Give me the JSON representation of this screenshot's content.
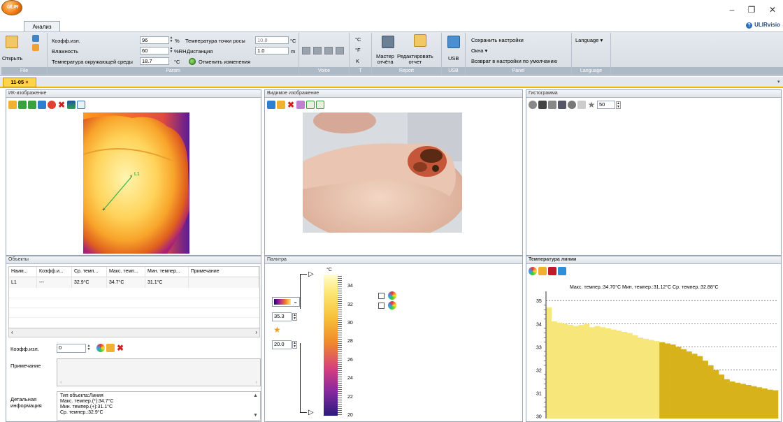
{
  "window": {
    "app_name": "ULIRvisio",
    "minimize": "–",
    "restore": "❐",
    "close": "✕",
    "logo_text": "ULIR"
  },
  "tabs": {
    "analysis": "Анализ"
  },
  "ribbon": {
    "file": {
      "label": "File",
      "open": "Открыть"
    },
    "param": {
      "label": "Param",
      "emissivity_label": "Коэфф.изл.",
      "emissivity_value": "96",
      "emissivity_unit": "%",
      "humidity_label": "Влажность",
      "humidity_value": "60",
      "humidity_unit": "%RH",
      "ambient_label": "Температура окружающей среды",
      "ambient_value": "18.7",
      "ambient_unit": "°C",
      "dewpoint_label": "Температура точки росы",
      "dewpoint_value": "10.8",
      "dewpoint_unit": "°C",
      "distance_label": "Дистанция",
      "distance_value": "1.0",
      "distance_unit": "m",
      "undo_label": "Отменить изменения"
    },
    "voice": {
      "label": "Voice"
    },
    "temp_units": {
      "label": "T",
      "c": "°C",
      "f": "°F",
      "k": "K"
    },
    "report": {
      "label": "Report",
      "wizard": "Мастер\nотчёта",
      "edit": "Редактировать\nотчет"
    },
    "usb": {
      "label": "USB",
      "button": "USB"
    },
    "panel": {
      "label": "Panel",
      "save": "Сохранить настройки",
      "windows": "Окна",
      "reset": "Возврат в настройки по умолчанию"
    },
    "language": {
      "label": "Language",
      "button": "Language"
    }
  },
  "doc_tab": {
    "name": "11-05",
    "close": "×"
  },
  "panels": {
    "ir": {
      "title": "ИК-изображение",
      "line_label": "L1"
    },
    "visible": {
      "title": "Видимое изображение"
    },
    "histogram": {
      "title": "Гистограмма",
      "value": "50"
    },
    "objects": {
      "title": "Объекты",
      "columns": [
        "Наим...",
        "Коэфф.и...",
        "Ср. темп...",
        "Макс. темп...",
        "Мин. темпер...",
        "Примечание"
      ],
      "rows": [
        [
          "L1",
          "---",
          "32.9°C",
          "34.7°C",
          "31.1°C",
          ""
        ]
      ],
      "emissivity_label": "Коэфф.изл.",
      "emissivity_value": "0",
      "note_label": "Примечание",
      "detail_label": "Детальная\nинформация",
      "detail_text": "Тип объекта:Линия\nМакс. темпер.(*):34.7°C\nМин. темпер.(+):31.1°C\nСр. темпер.:32.9°C"
    },
    "palette": {
      "title": "Палитра",
      "max_value": "35.3",
      "min_value": "20.0",
      "unit": "°C",
      "ticks": [
        "34",
        "32",
        "30",
        "28",
        "26",
        "24",
        "22",
        "20"
      ]
    },
    "line_temp": {
      "title": "Температура линии",
      "summary": "Макс. темпер.:34.70°C Мин. темпер.:31.12°C Ср. темпер.:32.88°C"
    }
  },
  "chart_data": {
    "type": "bar",
    "title": "Макс. темпер.:34.70°C Мин. темпер.:31.12°C Ср. темпер.:32.88°C",
    "xlabel": "",
    "ylabel": "",
    "ylim": [
      29.9,
      35.4
    ],
    "yticks": [
      "35",
      "34",
      "33",
      "32",
      "31",
      "30"
    ],
    "grid": true,
    "values": [
      34.7,
      34.1,
      34.05,
      34.0,
      33.95,
      33.9,
      33.95,
      34.0,
      33.85,
      33.9,
      33.85,
      33.8,
      33.75,
      33.7,
      33.65,
      33.6,
      33.5,
      33.4,
      33.35,
      33.3,
      33.25,
      33.2,
      33.15,
      33.1,
      33.0,
      32.9,
      32.8,
      32.7,
      32.6,
      32.4,
      32.2,
      32.0,
      31.8,
      31.6,
      31.5,
      31.45,
      31.4,
      31.35,
      31.3,
      31.25,
      31.2,
      31.15,
      31.12
    ],
    "colors": {
      "bar_hi": "#f7e67a",
      "bar_lo": "#d8b21a"
    }
  },
  "colors": {
    "accent": "#f3b300",
    "ribbon_group": "#aeb9c6"
  }
}
